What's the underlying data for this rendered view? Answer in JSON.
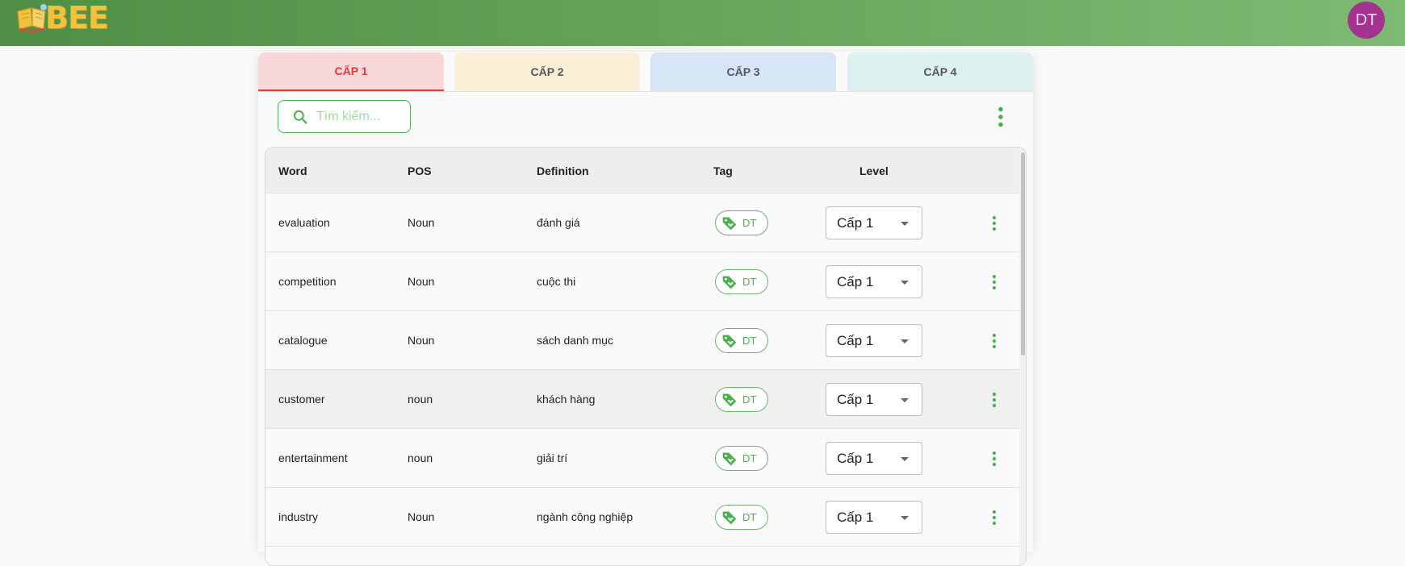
{
  "app": {
    "logo_text": "BEE",
    "user_initials": "DT",
    "colors": {
      "header": "#5b9b50",
      "accent": "#4caf50",
      "active_tab": "#e53935",
      "avatar": "#a3338f"
    }
  },
  "tabs": [
    {
      "label": "CẤP 1",
      "active": true,
      "color": "#f8d7da"
    },
    {
      "label": "CẤP 2",
      "active": false,
      "color": "#faf0d7"
    },
    {
      "label": "CẤP 3",
      "active": false,
      "color": "#d6e6f7"
    },
    {
      "label": "CẤP 4",
      "active": false,
      "color": "#dcf0f0"
    }
  ],
  "toolbar": {
    "search_placeholder": "Tìm kiếm...",
    "search_icon": "search-icon",
    "more_icon": "more-vertical-icon"
  },
  "table": {
    "headers": {
      "word": "Word",
      "pos": "POS",
      "definition": "Definition",
      "tag": "Tag",
      "level": "Level"
    },
    "rows": [
      {
        "word": "evaluation",
        "pos": "Noun",
        "definition": "đánh giá",
        "tag": "DT",
        "level": "Cấp 1"
      },
      {
        "word": "competition",
        "pos": "Noun",
        "definition": "cuộc thi",
        "tag": "DT",
        "level": "Cấp 1"
      },
      {
        "word": "catalogue",
        "pos": "Noun",
        "definition": "sách danh mục",
        "tag": "DT",
        "level": "Cấp 1"
      },
      {
        "word": "customer",
        "pos": "noun",
        "definition": "khách hàng",
        "tag": "DT",
        "level": "Cấp 1"
      },
      {
        "word": "entertainment",
        "pos": "noun",
        "definition": "giải trí",
        "tag": "DT",
        "level": "Cấp 1"
      },
      {
        "word": "industry",
        "pos": "Noun",
        "definition": "ngành công nghiệp",
        "tag": "DT",
        "level": "Cấp 1"
      }
    ]
  }
}
